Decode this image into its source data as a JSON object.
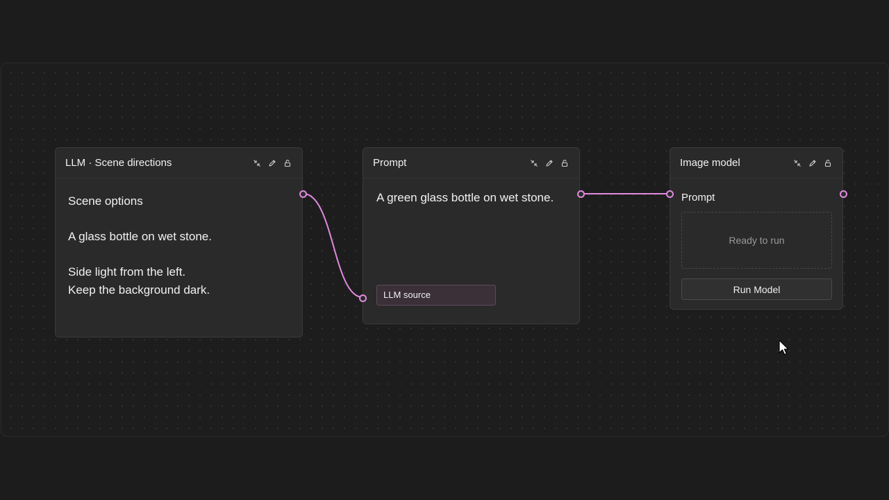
{
  "theme": {
    "accent_color": "#e08be0",
    "background": "#1c1c1c",
    "node_background": "#2a2a2a"
  },
  "nodes": {
    "llm": {
      "title": "LLM · Scene directions",
      "icons": [
        "collapse-icon",
        "edit-icon",
        "unlock-icon"
      ],
      "lines": [
        "Scene options",
        "",
        "A glass bottle on wet stone.",
        "",
        "Side light from the left.",
        "Keep the background dark."
      ]
    },
    "prompt": {
      "title": "Prompt",
      "icons": [
        "collapse-icon",
        "edit-icon",
        "unlock-icon"
      ],
      "text": "A green glass bottle on wet stone.",
      "source_label": "LLM source"
    },
    "image_model": {
      "title": "Image model",
      "icons": [
        "collapse-icon",
        "edit-icon",
        "unlock-icon"
      ],
      "input_label": "Prompt",
      "status": "Ready to run",
      "run_button": "Run Model"
    }
  }
}
